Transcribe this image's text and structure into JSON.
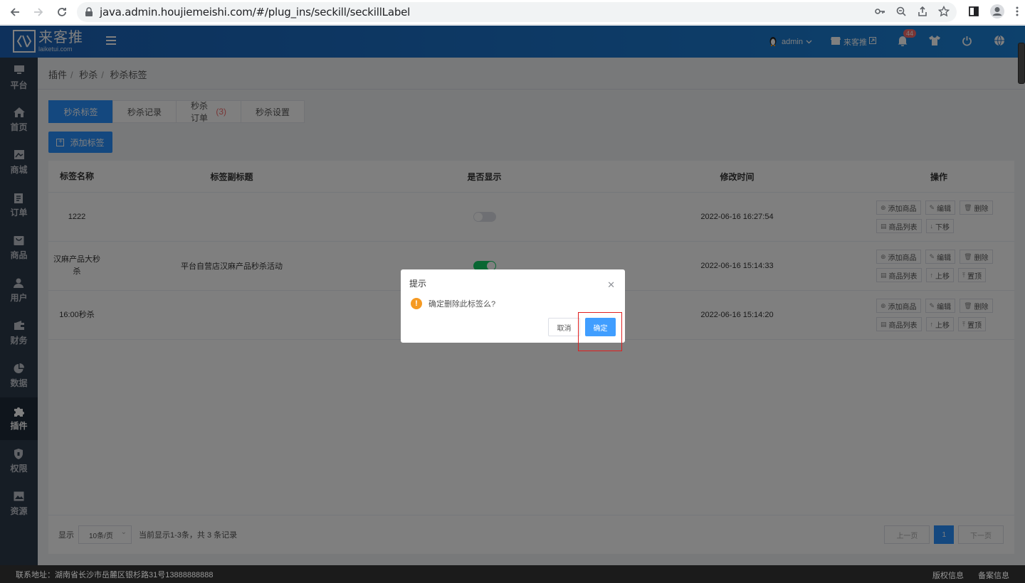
{
  "browser": {
    "url": "java.admin.houjiemeishi.com/#/plug_ins/seckill/seckillLabel"
  },
  "header": {
    "logo_cn": "来客推",
    "logo_en": "laiketui.com",
    "user": "admin",
    "store": "来客推",
    "notification_count": "44"
  },
  "sidebar": {
    "items": [
      {
        "label": "平台",
        "icon": "platform-icon"
      },
      {
        "label": "首页",
        "icon": "home-icon"
      },
      {
        "label": "商城",
        "icon": "mall-icon"
      },
      {
        "label": "订单",
        "icon": "order-icon"
      },
      {
        "label": "商品",
        "icon": "goods-icon"
      },
      {
        "label": "用户",
        "icon": "user-icon"
      },
      {
        "label": "财务",
        "icon": "wallet-icon"
      },
      {
        "label": "数据",
        "icon": "pie-chart-icon"
      },
      {
        "label": "插件",
        "icon": "puzzle-icon"
      },
      {
        "label": "权限",
        "icon": "shield-icon"
      },
      {
        "label": "资源",
        "icon": "image-icon"
      }
    ],
    "active": "插件"
  },
  "breadcrumb": [
    "插件",
    "秒杀",
    "秒杀标签"
  ],
  "tabs": {
    "t1": "秒杀标签",
    "t2": "秒杀记录",
    "t3": "秒杀订单",
    "t3_count": "(3)",
    "t4": "秒杀设置"
  },
  "add_button": "添加标签",
  "table": {
    "headers": {
      "name": "标签名称",
      "subtitle": "标签副标题",
      "show": "是否显示",
      "time": "修改时间",
      "ops": "操作"
    },
    "rows": [
      {
        "name": "1222",
        "subtitle": "",
        "show": false,
        "time": "2022-06-16 16:27:54"
      },
      {
        "name": "汉麻产品大秒杀",
        "subtitle": "平台自营店汉麻产品秒杀活动",
        "show": true,
        "time": "2022-06-16 15:14:33"
      },
      {
        "name": "16:00秒杀",
        "subtitle": "",
        "show": true,
        "time": "2022-06-16 15:14:20"
      }
    ],
    "ops": {
      "add_goods": "添加商品",
      "edit": "编辑",
      "delete": "删除",
      "goods_list": "商品列表",
      "move_down": "下移",
      "move_up": "上移",
      "top": "置顶"
    }
  },
  "pagination": {
    "show_label": "显示",
    "page_size": "10条/页",
    "summary": "当前显示1-3条，共 3 条记录",
    "prev": "上一页",
    "current": "1",
    "next": "下一页"
  },
  "dialog": {
    "title": "提示",
    "message": "确定删除此标签么?",
    "cancel": "取消",
    "confirm": "确定"
  },
  "footer": {
    "address": "联系地址：湖南省长沙市岳麓区银杉路31号13888888888",
    "copyright": "版权信息",
    "icp": "备案信息"
  }
}
